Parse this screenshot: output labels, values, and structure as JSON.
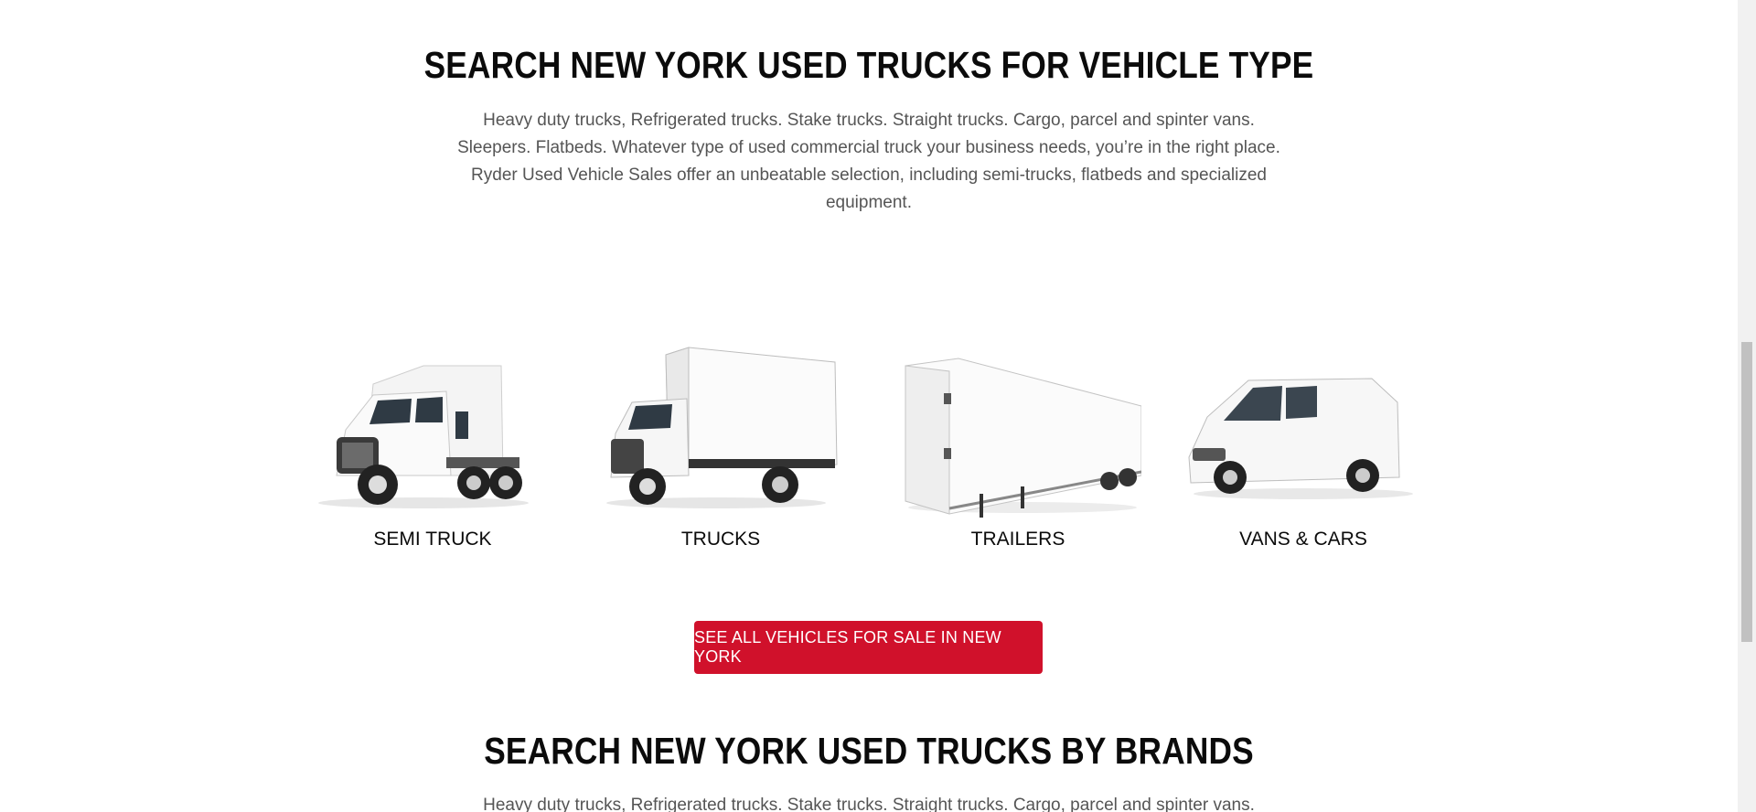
{
  "section_vehicle_type": {
    "title": "SEARCH NEW YORK USED TRUCKS FOR VEHICLE TYPE",
    "description": "Heavy duty trucks, Refrigerated trucks. Stake trucks. Straight trucks. Cargo, parcel and spinter vans. Sleepers. Flatbeds. Whatever type of used commercial truck your business needs, you’re in the right place. Ryder Used Vehicle Sales offer an unbeatable selection, including semi-trucks, flatbeds and specialized equipment."
  },
  "vehicle_types": [
    {
      "label": "SEMI TRUCK",
      "icon": "semi-truck-image"
    },
    {
      "label": "TRUCKS",
      "icon": "box-truck-image"
    },
    {
      "label": "TRAILERS",
      "icon": "trailer-image"
    },
    {
      "label": "VANS & CARS",
      "icon": "van-image"
    }
  ],
  "cta": {
    "label": "SEE ALL VEHICLES FOR SALE IN NEW YORK",
    "color": "#d0112b"
  },
  "section_brands": {
    "title": "SEARCH NEW YORK USED TRUCKS BY BRANDS",
    "description": "Heavy duty trucks, Refrigerated trucks. Stake trucks. Straight trucks. Cargo, parcel and spinter vans."
  }
}
